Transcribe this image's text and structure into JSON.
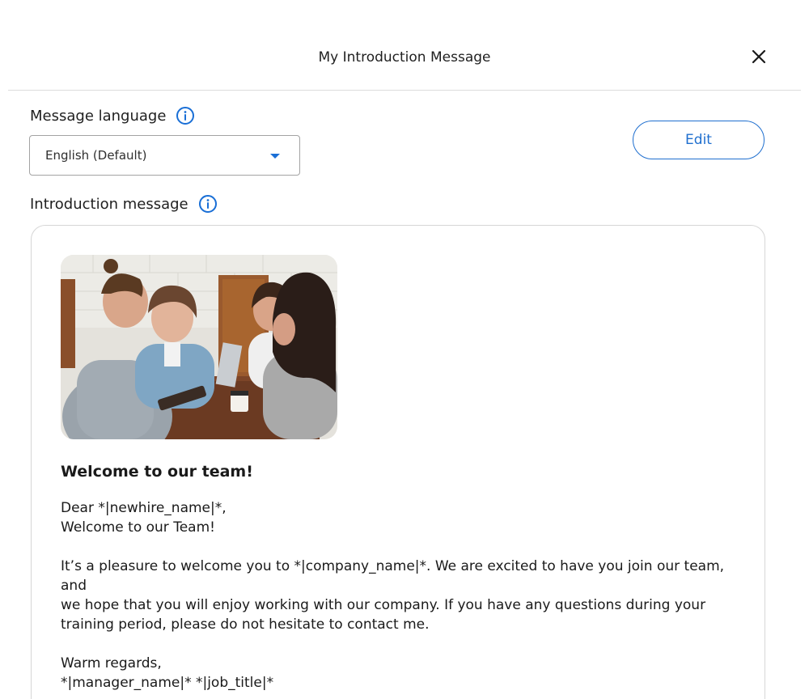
{
  "dialog": {
    "title": "My Introduction Message",
    "close_icon": "close-icon"
  },
  "language": {
    "label": "Message language",
    "info_icon": "info-icon",
    "selected": "English (Default)",
    "caret_icon": "caret-down-icon",
    "accent": "#1a6fd6"
  },
  "actions": {
    "edit_label": "Edit"
  },
  "intro": {
    "label": "Introduction message",
    "info_icon": "info-icon"
  },
  "message": {
    "image": "team-photo",
    "heading": "Welcome to our team!",
    "greeting_line1": "Dear *|newhire_name|*,",
    "greeting_line2": "Welcome to our Team!",
    "paragraph_line1": "It’s a pleasure to welcome you to *|company_name|*. We are excited to have you join our team, and",
    "paragraph_line2": "we hope that you will enjoy working with our company. If you have any questions during your",
    "paragraph_line3": "training period, please do not hesitate to contact me.",
    "signoff": "Warm regards,",
    "signature": "*|manager_name|* *|job_title|*"
  }
}
